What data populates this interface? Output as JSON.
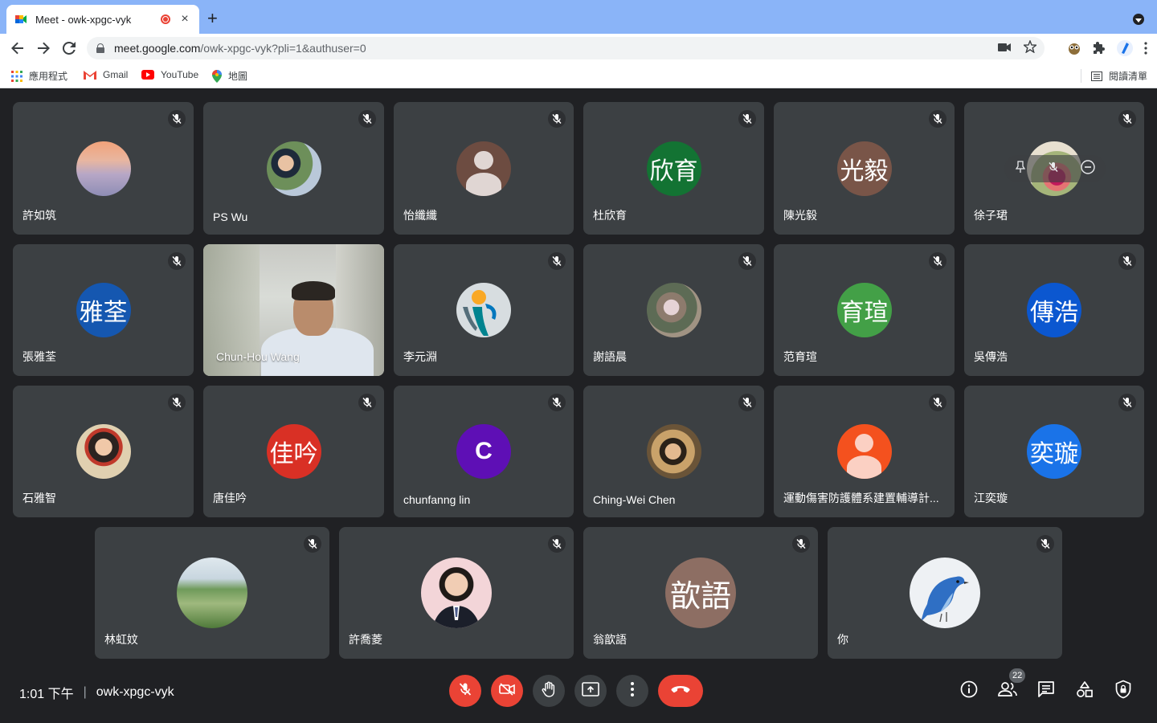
{
  "browser": {
    "tab_title": "Meet - owk-xpgc-vyk",
    "close_glyph": "×",
    "new_tab_glyph": "+",
    "url_host": "meet.google.com",
    "url_path": "/owk-xpgc-vyk?pli=1&authuser=0",
    "bookmarks": [
      {
        "label": "應用程式",
        "icon": "apps-grid-icon"
      },
      {
        "label": "Gmail",
        "icon": "gmail-icon"
      },
      {
        "label": "YouTube",
        "icon": "youtube-icon"
      },
      {
        "label": "地圖",
        "icon": "maps-pin-icon"
      }
    ],
    "reading_list": "閱讀清單"
  },
  "participants": [
    {
      "name": "許如筑",
      "avatar": "photo-sunset",
      "muted": true
    },
    {
      "name": "PS Wu",
      "avatar": "photo-person",
      "muted": true
    },
    {
      "name": "怡纖纖",
      "avatar": "default-silhouette",
      "muted": true
    },
    {
      "name": "杜欣育",
      "avatar_text": "欣育",
      "color": "#137333",
      "muted": true
    },
    {
      "name": "陳光毅",
      "avatar_text": "光毅",
      "color": "#795548",
      "muted": true
    },
    {
      "name": "徐子珺",
      "avatar": "photo-flower",
      "muted": true
    },
    {
      "name": "張雅荃",
      "avatar_text": "雅荃",
      "color": "#1557b0",
      "muted": true
    },
    {
      "name": "Chun-Hou Wang",
      "avatar": "live-video",
      "muted": false
    },
    {
      "name": "李元淵",
      "avatar": "logo-figure",
      "muted": true
    },
    {
      "name": "謝語晨",
      "avatar": "photo-child",
      "muted": true
    },
    {
      "name": "范育瑄",
      "avatar_text": "育瑄",
      "color": "#43a047",
      "muted": true
    },
    {
      "name": "吳傳浩",
      "avatar_text": "傳浩",
      "color": "#0b57d0",
      "muted": true
    },
    {
      "name": "石雅智",
      "avatar": "photo-girl",
      "muted": true
    },
    {
      "name": "唐佳吟",
      "avatar_text": "佳吟",
      "color": "#d93025",
      "muted": true
    },
    {
      "name": "chunfanng lin",
      "avatar_text": "C",
      "color": "#5e0fb5",
      "muted": true
    },
    {
      "name": "Ching-Wei Chen",
      "avatar": "photo-boy",
      "muted": true
    },
    {
      "name": "運動傷害防護體系建置輔導計...",
      "avatar": "default-silhouette-orange",
      "muted": true
    },
    {
      "name": "江奕璇",
      "avatar_text": "奕璇",
      "color": "#1a73e8",
      "muted": true
    },
    {
      "name": "林虹妏",
      "avatar": "photo-landscape",
      "muted": true
    },
    {
      "name": "許喬菱",
      "avatar": "photo-student",
      "muted": true
    },
    {
      "name": "翁歆語",
      "avatar_text": "歆語",
      "color": "#8d6e63",
      "muted": true
    },
    {
      "name": "你",
      "avatar": "photo-bluebird",
      "muted": true
    }
  ],
  "bottom": {
    "time": "1:01 下午",
    "separator": "|",
    "meeting_code": "owk-xpgc-vyk",
    "participant_count": "22"
  },
  "colors": {
    "background": "#202124",
    "tile": "#3c4043",
    "danger": "#ea4335",
    "tabstrip": "#8ab4f8"
  }
}
